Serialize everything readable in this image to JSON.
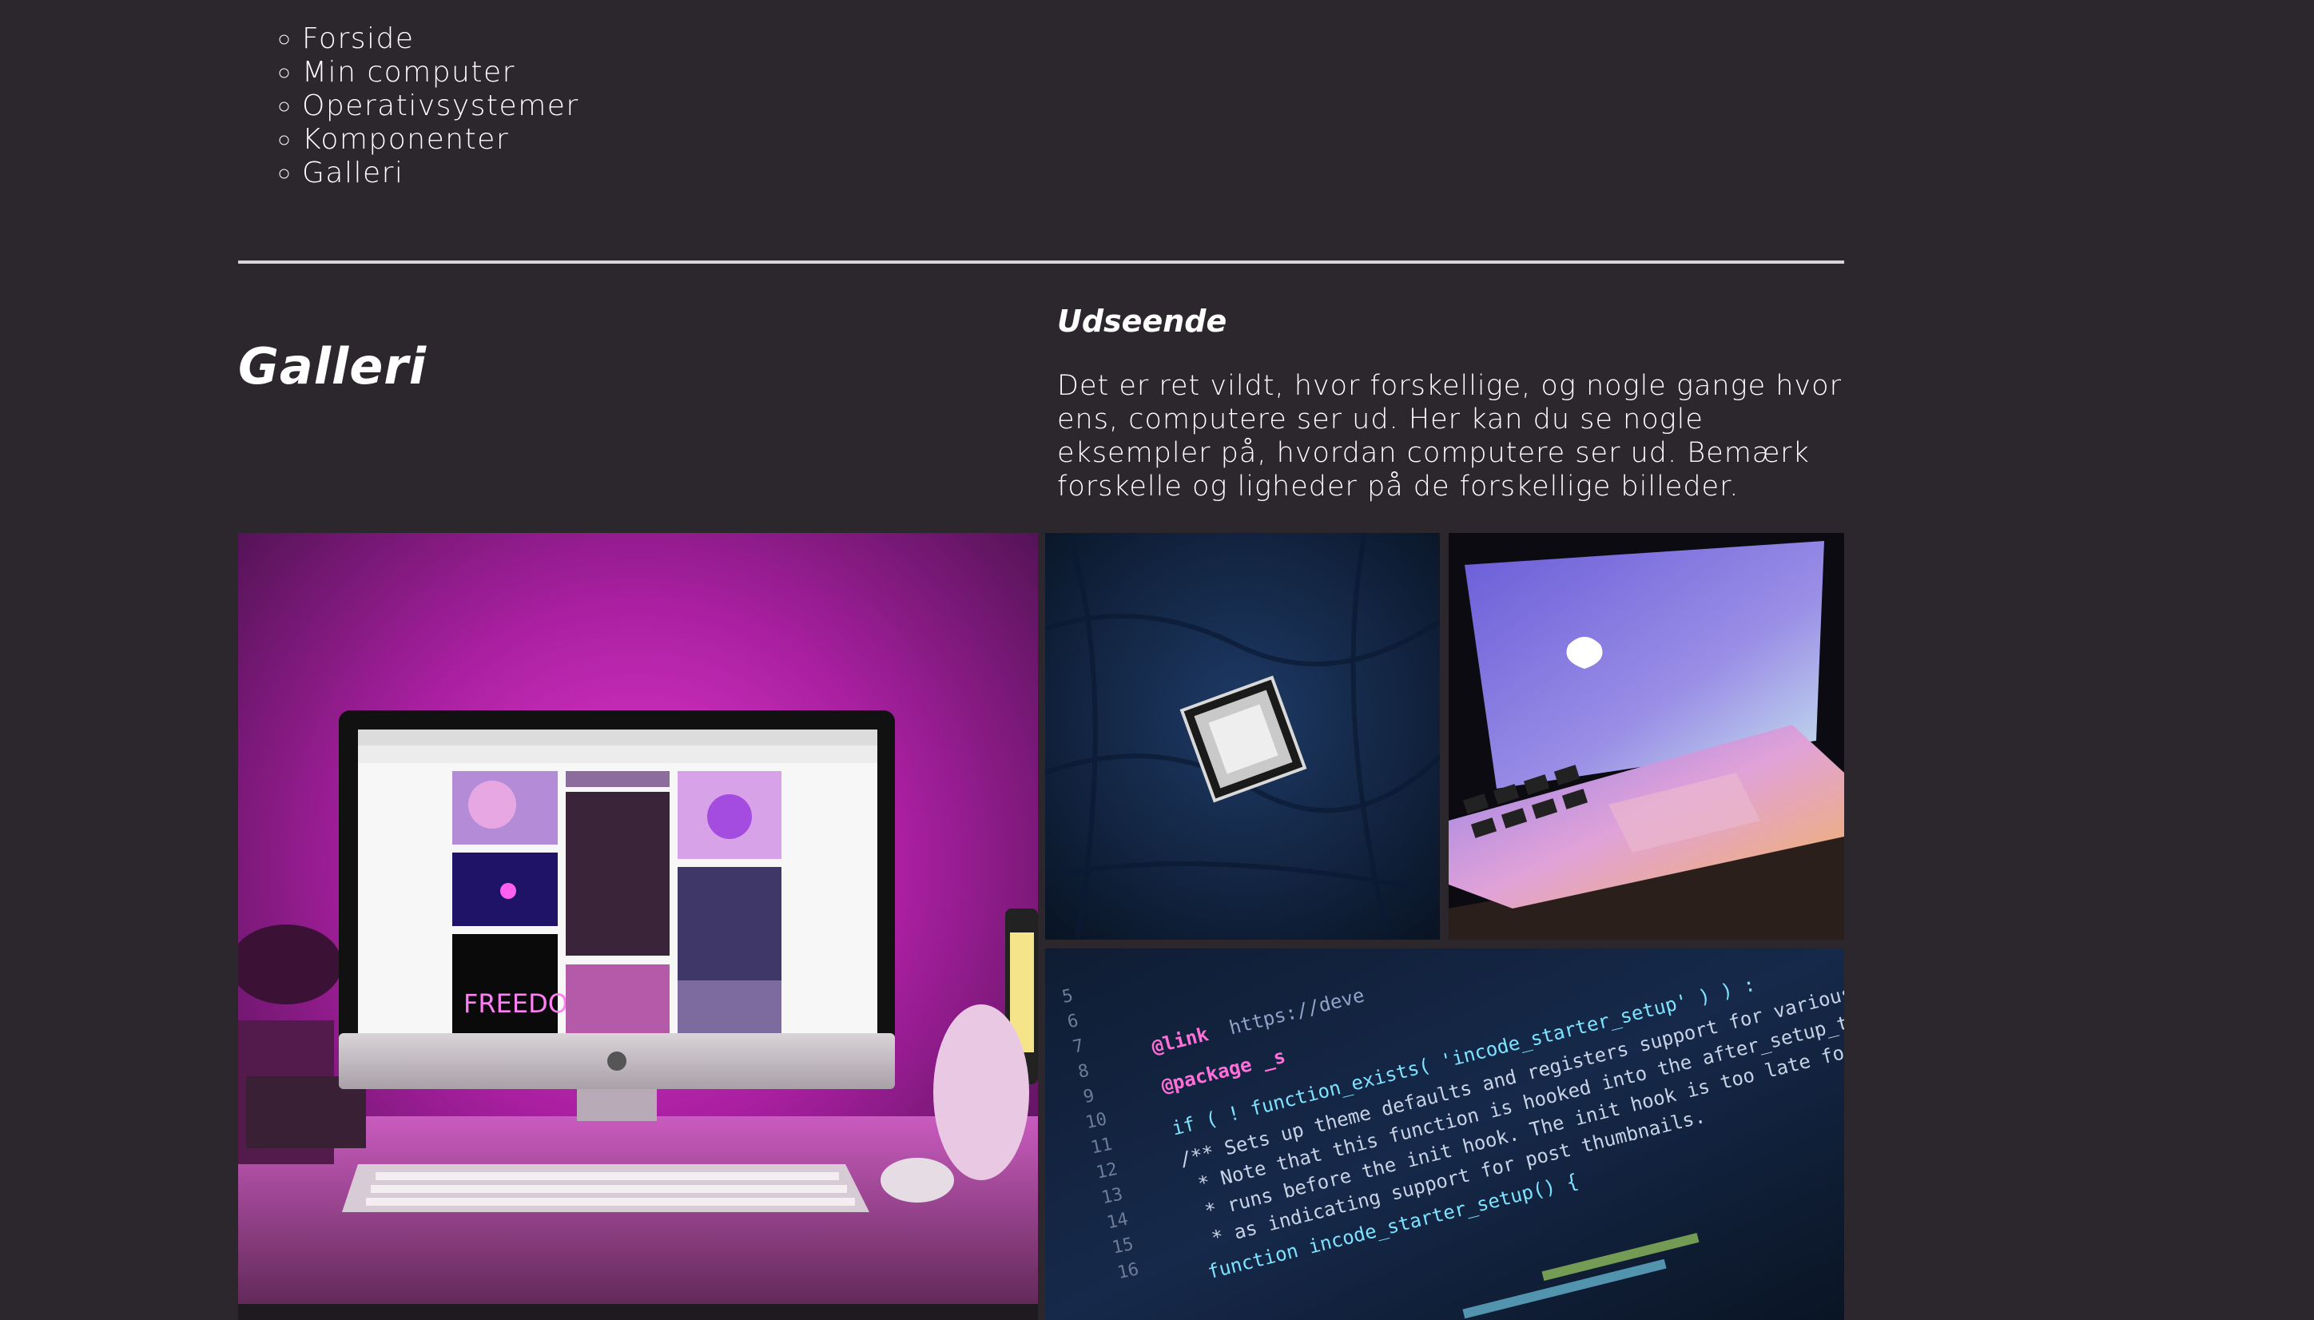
{
  "nav": {
    "items": [
      {
        "label": "Forside"
      },
      {
        "label": "Min computer"
      },
      {
        "label": "Operativsystemer"
      },
      {
        "label": "Komponenter"
      },
      {
        "label": "Galleri"
      }
    ]
  },
  "page": {
    "title": "Galleri"
  },
  "section": {
    "heading": "Udseende",
    "text": "Det er ret vildt, hvor forskellige, og nogle gange hvor ens, computere ser ud. Her kan du se nogle eksempler på, hvordan computere ser ud. Bemærk forskelle og ligheder på de forskellige billeder."
  },
  "gallery": {
    "screen_text": "FREEDOM",
    "code_text": {
      "link": "@link",
      "url": "https://deve",
      "package": "@package _s",
      "line1": "if ( ! function_exists( 'incode_starter_setup' ) ) :",
      "line2": "/** Sets up theme defaults and registers support for various WordPress",
      "line3": "* Note that this function is hooked into the after_setup_theme hook, which",
      "line4": "* runs before the init hook. The init hook is too late for some features,",
      "line5": "* as indicating support for post thumbnails.",
      "line6": "function incode_starter_setup() {",
      "line_numbers": [
        "5",
        "6",
        "7",
        "8",
        "9",
        "10",
        "11",
        "12",
        "13",
        "14",
        "15",
        "16"
      ]
    }
  }
}
